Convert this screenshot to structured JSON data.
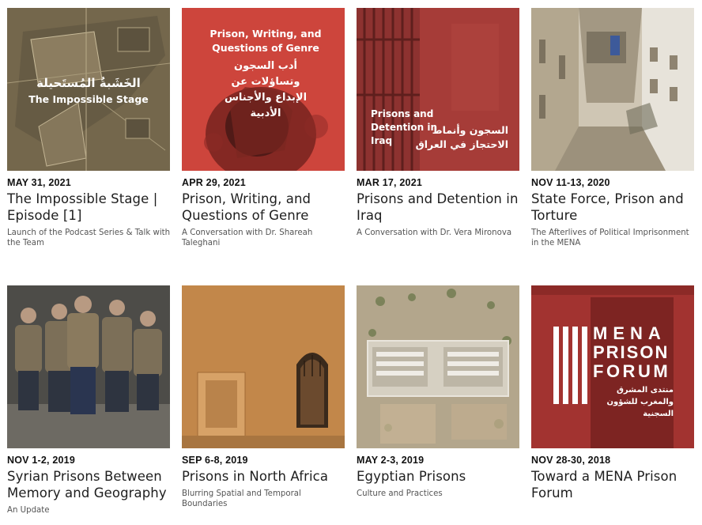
{
  "events": [
    {
      "date": "MAY 31, 2021",
      "title": "The Impossible Stage | Episode [1]",
      "subtitle": "Launch of the Podcast Series & Talk with the Team",
      "image_text": {
        "arabic": "الخَشَبةُ المُستَحيلة",
        "english": "The Impossible Stage"
      },
      "colors": {
        "bg": "#6f6247"
      }
    },
    {
      "date": "APR 29, 2021",
      "title": "Prison, Writing, and Questions of Genre",
      "subtitle": "A Conversation with Dr. Shareah Taleghani",
      "image_text": {
        "english": "Prison, Writing, and Questions of Genre",
        "arabic": "أدب السجون وتساؤلات عن الإبداع والأجناس الأدبية"
      },
      "colors": {
        "bg": "#c9423a"
      }
    },
    {
      "date": "MAR 17, 2021",
      "title": "Prisons and Detention in Iraq",
      "subtitle": "A Conversation with Dr. Vera Mironova",
      "image_text": {
        "english": "Prisons and Detention in Iraq",
        "arabic": "السجون وأنماط الاحتجاز في العراق"
      },
      "colors": {
        "bg": "#a23a37"
      }
    },
    {
      "date": "NOV 11-13, 2020",
      "title": "State Force, Prison and Torture",
      "subtitle": "The Afterlives of Political Imprisonment in the MENA",
      "colors": {
        "bg": "#b7ad98"
      }
    },
    {
      "date": "NOV 1-2, 2019",
      "title": "Syrian Prisons Between Memory and Geography",
      "subtitle": "An Update",
      "colors": {
        "bg": "#5a5a55"
      }
    },
    {
      "date": "SEP 6-8, 2019",
      "title": "Prisons in North Africa",
      "subtitle": "Blurring Spatial and Temporal Boundaries",
      "colors": {
        "bg": "#c48a4c"
      }
    },
    {
      "date": "MAY 2-3, 2019",
      "title": "Egyptian Prisons",
      "subtitle": "Culture and Practices",
      "colors": {
        "bg": "#a99c84"
      }
    },
    {
      "date": "NOV 28-30, 2018",
      "title": "Toward a MENA Prison Forum",
      "subtitle": "",
      "image_text": {
        "logo_line1": "MENA",
        "logo_line2": "PRISON",
        "logo_line3": "FORUM",
        "arabic": "منتدى المشرق والمغرب للشؤون السجنية"
      },
      "colors": {
        "bg": "#9c2f2c"
      }
    }
  ]
}
